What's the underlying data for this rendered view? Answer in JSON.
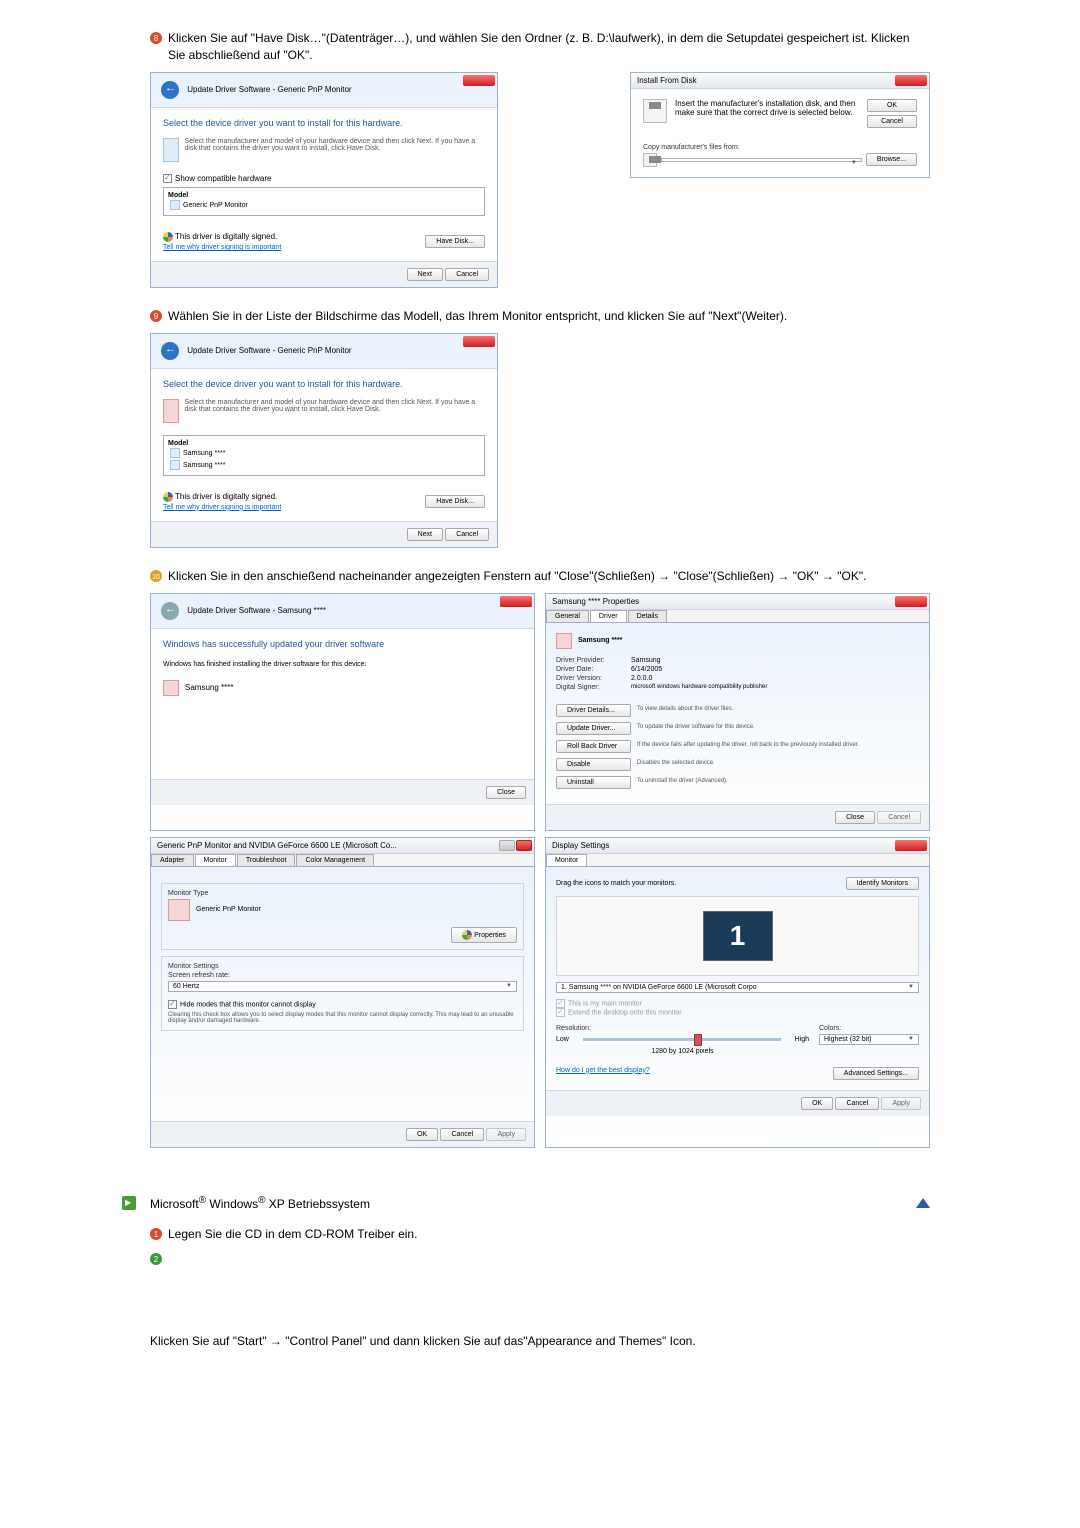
{
  "step8": {
    "text": "Klicken Sie auf \"Have Disk…\"(Datenträger…), und wählen Sie den Ordner (z. B. D:\\laufwerk), in dem die Setupdatei gespeichert ist. Klicken Sie abschließend auf \"OK\".",
    "dialog_left": {
      "crumb": "Update Driver Software - Generic PnP Monitor",
      "heading": "Select the device driver you want to install for this hardware.",
      "subtext": "Select the manufacturer and model of your hardware device and then click Next. If you have a disk that contains the driver you want to install, click Have Disk.",
      "show_compat": "Show compatible hardware",
      "model_label": "Model",
      "model_item": "Generic PnP Monitor",
      "signed": "This driver is digitally signed.",
      "signed_link": "Tell me why driver signing is important",
      "have_disk": "Have Disk...",
      "next": "Next",
      "cancel": "Cancel"
    },
    "dialog_right": {
      "title": "Install From Disk",
      "msg": "Insert the manufacturer's installation disk, and then make sure that the correct drive is selected below.",
      "ok": "OK",
      "cancel": "Cancel",
      "copy_label": "Copy manufacturer's files from:",
      "browse": "Browse..."
    }
  },
  "step9": {
    "text": "Wählen Sie in der Liste der Bildschirme das Modell, das Ihrem Monitor entspricht, und klicken Sie auf \"Next\"(Weiter).",
    "dialog": {
      "crumb": "Update Driver Software - Generic PnP Monitor",
      "heading": "Select the device driver you want to install for this hardware.",
      "subtext": "Select the manufacturer and model of your hardware device and then click Next. If you have a disk that contains the driver you want to install, click Have Disk.",
      "model_label": "Model",
      "model_item1": "Samsung ****",
      "model_item2": "Samsung ****",
      "signed": "This driver is digitally signed.",
      "signed_link": "Tell me why driver signing is important",
      "have_disk": "Have Disk...",
      "next": "Next",
      "cancel": "Cancel"
    }
  },
  "step10": {
    "text": "Klicken Sie in den anschießend nacheinander angezeigten Fenstern auf \"Close\"(Schließen) → \"Close\"(Schließen) → \"OK\" → \"OK\".",
    "dlg_a": {
      "crumb": "Update Driver Software - Samsung ****",
      "heading": "Windows has successfully updated your driver software",
      "subtext": "Windows has finished installing the driver software for this device:",
      "device": "Samsung ****",
      "close": "Close"
    },
    "dlg_b": {
      "title": "Samsung **** Properties",
      "tab_general": "General",
      "tab_driver": "Driver",
      "tab_details": "Details",
      "device": "Samsung ****",
      "provider_l": "Driver Provider:",
      "provider_v": "Samsung",
      "date_l": "Driver Date:",
      "date_v": "6/14/2005",
      "ver_l": "Driver Version:",
      "ver_v": "2.0.0.0",
      "signer_l": "Digital Signer:",
      "signer_v": "microsoft windows hardware compatibility publisher",
      "btn_details": "Driver Details...",
      "desc_details": "To view details about the driver files.",
      "btn_update": "Update Driver...",
      "desc_update": "To update the driver software for this device.",
      "btn_rollback": "Roll Back Driver",
      "desc_rollback": "If the device fails after updating the driver, roll back to the previously installed driver.",
      "btn_disable": "Disable",
      "desc_disable": "Disables the selected device.",
      "btn_uninstall": "Uninstall",
      "desc_uninstall": "To uninstall the driver (Advanced).",
      "close": "Close",
      "cancel": "Cancel"
    },
    "dlg_c": {
      "title": "Generic PnP Monitor and NVIDIA GeForce 6600 LE (Microsoft Co...",
      "tab_adapter": "Adapter",
      "tab_monitor": "Monitor",
      "tab_trouble": "Troubleshoot",
      "tab_color": "Color Management",
      "mtype": "Monitor Type",
      "mval": "Generic PnP Monitor",
      "properties": "Properties",
      "settings_label": "Monitor Settings",
      "refresh_label": "Screen refresh rate:",
      "refresh_val": "60 Hertz",
      "hide_modes": "Hide modes that this monitor cannot display",
      "hide_text": "Clearing this check box allows you to select display modes that this monitor cannot display correctly. This may lead to an unusable display and/or damaged hardware.",
      "ok": "OK",
      "cancel": "Cancel",
      "apply": "Apply"
    },
    "dlg_d": {
      "title": "Display Settings",
      "tab_monitor": "Monitor",
      "drag": "Drag the icons to match your monitors.",
      "identify": "Identify Monitors",
      "mon_num": "1",
      "select_label": "1. Samsung **** on NVIDIA GeForce 6600 LE (Microsoft Corpo",
      "main_mon": "This is my main monitor",
      "extend": "Extend the desktop onto this monitor",
      "res_label": "Resolution:",
      "low": "Low",
      "high": "High",
      "res_val": "1280 by 1024 pixels",
      "colors_label": "Colors:",
      "colors_val": "Highest (32 bit)",
      "best": "How do I get the best display?",
      "advanced": "Advanced Settings...",
      "ok": "OK",
      "cancel": "Cancel",
      "apply": "Apply"
    }
  },
  "xp_section": {
    "header": "Microsoft® Windows® XP Betriebssystem",
    "step1": "Legen Sie die CD in dem CD-ROM Treiber ein.",
    "step2": "Klicken Sie auf \"Start\" → \"Control Panel\" und dann klicken Sie auf das\"Appearance and Themes\" Icon."
  },
  "bullet_svg": {
    "n8": "8",
    "n9": "9",
    "n10": "10",
    "n1": "1",
    "n2": "2"
  }
}
